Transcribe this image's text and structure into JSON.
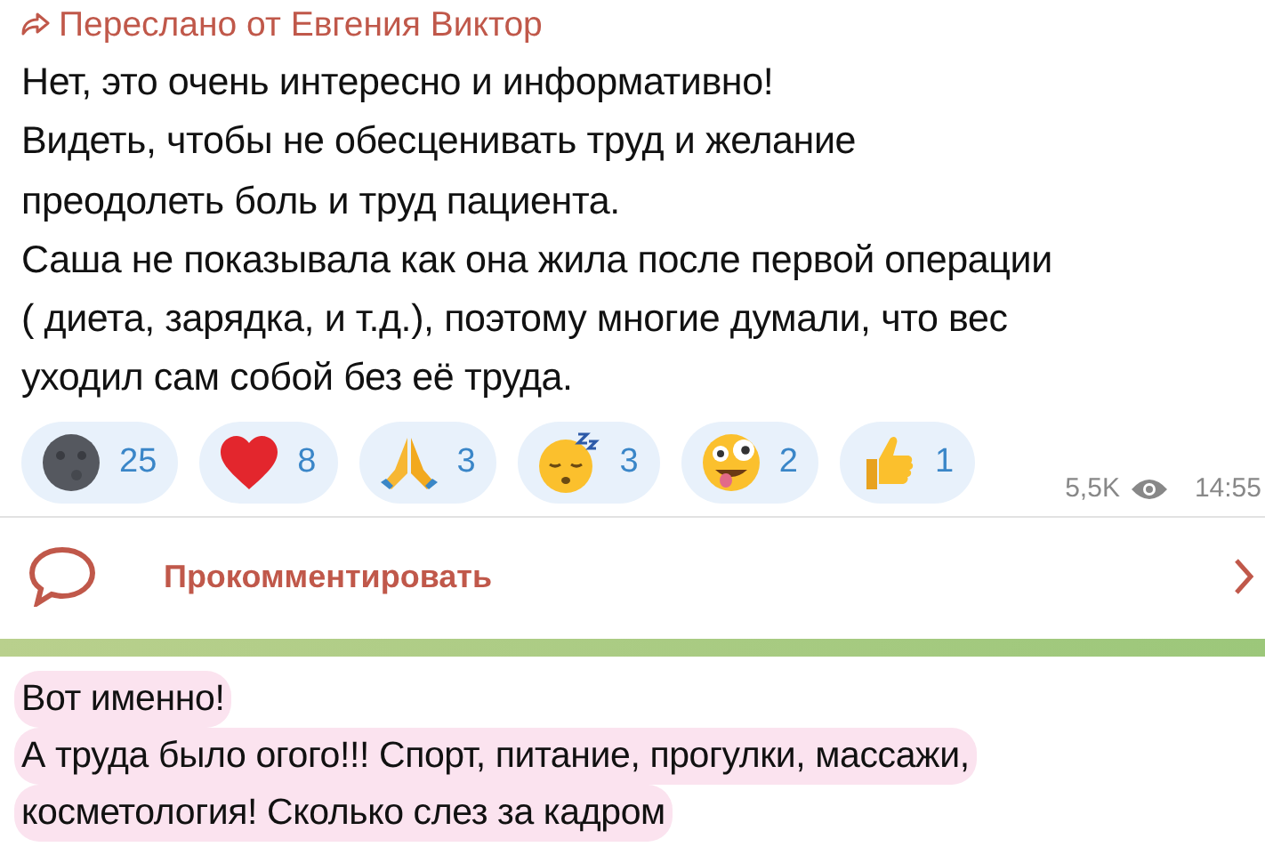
{
  "forwarded": {
    "label": "Переслано от Евгения Виктор"
  },
  "message": {
    "lines": [
      "Нет, это очень интересно и информативно!",
      "Видеть, чтобы не обесценивать труд и желание",
      "преодолеть боль и труд пациента.",
      "Саша не показывала как она жила после первой операции",
      "( диета, зарядка, и т.д.), поэтому многие думали, что вес",
      "уходил сам собой без её труда."
    ]
  },
  "reactions": [
    {
      "kind": "moon",
      "count": "25"
    },
    {
      "kind": "heart",
      "count": "8"
    },
    {
      "kind": "pray",
      "count": "3"
    },
    {
      "kind": "sleep",
      "count": "3"
    },
    {
      "kind": "crazy",
      "count": "2"
    },
    {
      "kind": "thumb",
      "count": "1"
    }
  ],
  "views": "5,5K",
  "time": "14:55",
  "comment": {
    "label": "Прокомментировать"
  },
  "reply": {
    "lines": [
      "Вот именно!",
      "А труда было огого!!! Спорт, питание, прогулки, массажи,",
      "косметология! Сколько слез за кадром"
    ]
  }
}
